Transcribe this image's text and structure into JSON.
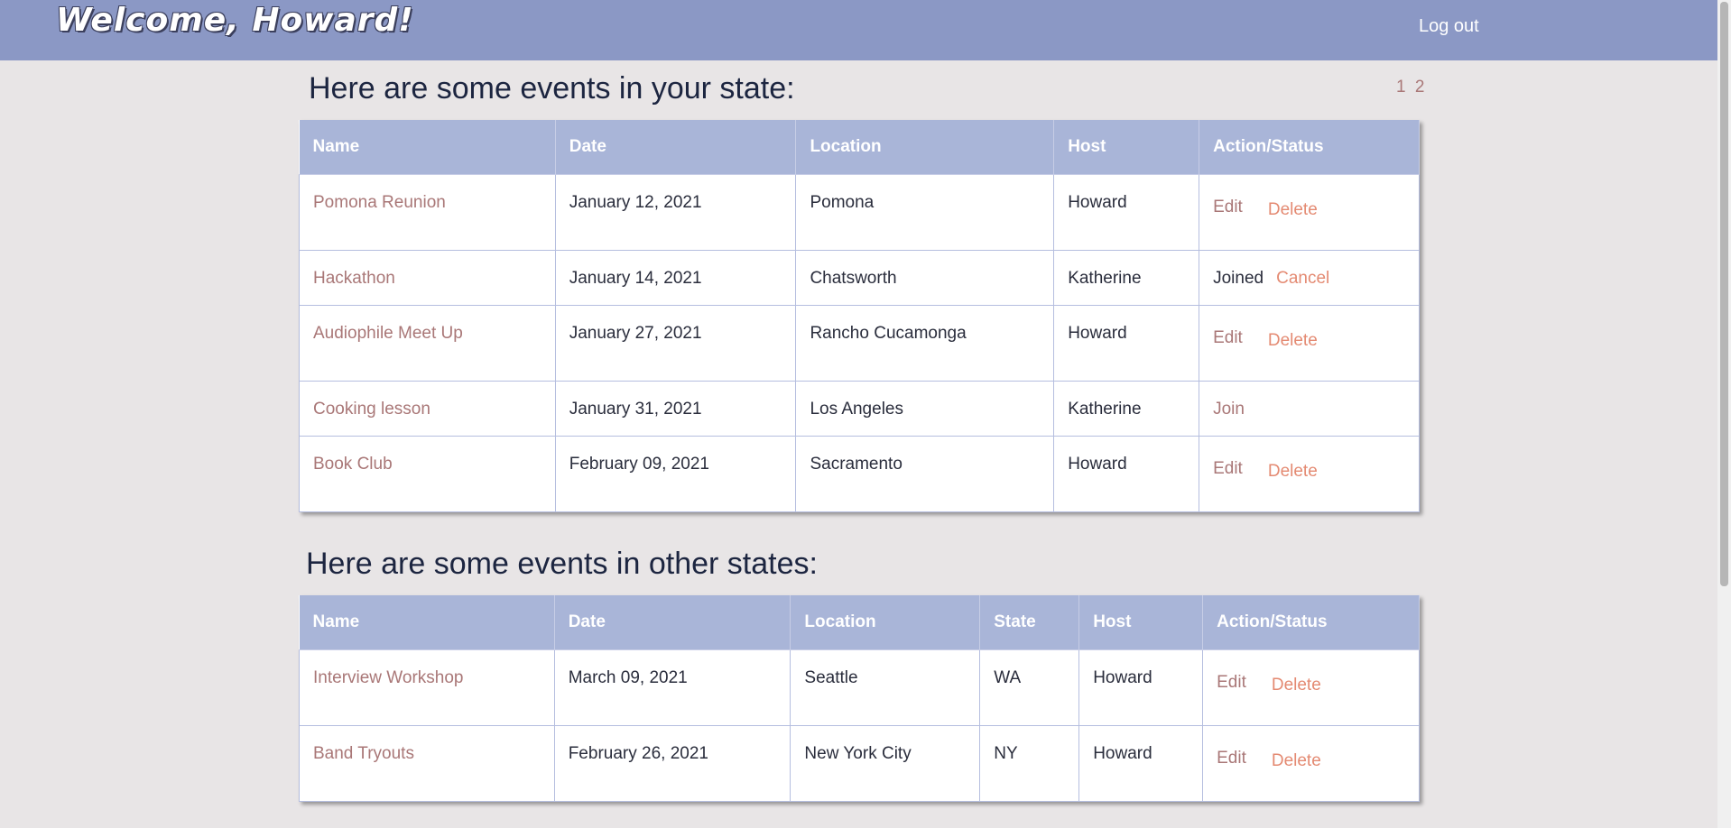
{
  "header": {
    "welcome": "Welcome, Howard!",
    "logout_label": "Log out"
  },
  "colors": {
    "header_bg": "#8b98c5",
    "table_header_bg": "#a9b5d8",
    "link": "#a97777",
    "danger": "#e48a72",
    "page_bg": "#e8e5e6"
  },
  "state_section": {
    "heading": "Here are some events in your state:",
    "pages": [
      "1",
      "2"
    ],
    "columns": [
      "Name",
      "Date",
      "Location",
      "Host",
      "Action/Status"
    ],
    "rows": [
      {
        "name": "Pomona Reunion",
        "date": "January 12, 2021",
        "location": "Pomona",
        "host": "Howard",
        "edit": "Edit",
        "delete": "Delete"
      },
      {
        "name": "Hackathon",
        "date": "January 14, 2021",
        "location": "Chatsworth",
        "host": "Katherine",
        "joined": "Joined",
        "cancel": "Cancel"
      },
      {
        "name": "Audiophile Meet Up",
        "date": "January 27, 2021",
        "location": "Rancho Cucamonga",
        "host": "Howard",
        "edit": "Edit",
        "delete": "Delete"
      },
      {
        "name": "Cooking lesson",
        "date": "January 31, 2021",
        "location": "Los Angeles",
        "host": "Katherine",
        "join": "Join"
      },
      {
        "name": "Book Club",
        "date": "February 09, 2021",
        "location": "Sacramento",
        "host": "Howard",
        "edit": "Edit",
        "delete": "Delete"
      }
    ]
  },
  "other_section": {
    "heading": "Here are some events in other states:",
    "columns": [
      "Name",
      "Date",
      "Location",
      "State",
      "Host",
      "Action/Status"
    ],
    "rows": [
      {
        "name": "Interview Workshop",
        "date": "March 09, 2021",
        "location": "Seattle",
        "state": "WA",
        "host": "Howard",
        "edit": "Edit",
        "delete": "Delete"
      },
      {
        "name": "Band Tryouts",
        "date": "February 26, 2021",
        "location": "New York City",
        "state": "NY",
        "host": "Howard",
        "edit": "Edit",
        "delete": "Delete"
      }
    ]
  }
}
